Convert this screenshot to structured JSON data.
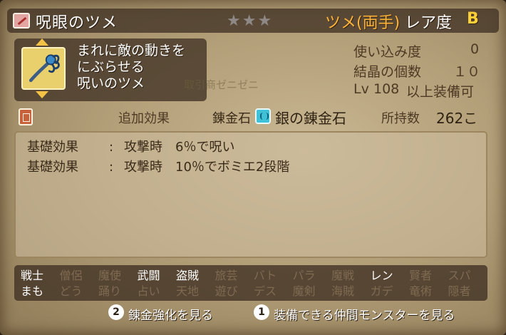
{
  "header": {
    "item_name": "呪眼のツメ",
    "stars": "★★★",
    "kind": "ツメ(両手)",
    "rarity_label": "レア度",
    "rarity_value": "B"
  },
  "item": {
    "description": [
      "まれに敵の動きを",
      "にぶらせる",
      "呪いのツメ"
    ],
    "icon": "claw-weapon-icon",
    "watermark": "取引商ゼニゼニ"
  },
  "stats": {
    "usage_label": "使い込み度",
    "usage_value": "0",
    "crystal_label": "結晶の個数",
    "crystal_value": "１０",
    "level_prefix": "Lv",
    "level_value": "108",
    "level_suffix": "以上装備可"
  },
  "effects_bar": {
    "added_effect_tab": "追加効果",
    "alchemy_stone_label": "錬金石",
    "alchemy_stone_name": "銀の錬金石",
    "owned_label": "所持数",
    "owned_value": "262こ"
  },
  "effects": [
    {
      "label": "基礎効果",
      "sep": ":",
      "text": "攻撃時　6％で呪い"
    },
    {
      "label": "基礎効果",
      "sep": ":",
      "text": "攻撃時　10％でボミエ2段階"
    }
  ],
  "jobs": {
    "row1": [
      {
        "label": "戦士",
        "on": true
      },
      {
        "label": "僧侶",
        "on": false
      },
      {
        "label": "魔使",
        "on": false
      },
      {
        "label": "武闘",
        "on": true
      },
      {
        "label": "盗賊",
        "on": true
      },
      {
        "label": "旅芸",
        "on": false
      },
      {
        "label": "バト",
        "on": false
      },
      {
        "label": "パラ",
        "on": false
      },
      {
        "label": "魔戦",
        "on": false
      },
      {
        "label": "レン",
        "on": true
      },
      {
        "label": "賢者",
        "on": false
      },
      {
        "label": "スパ",
        "on": false
      }
    ],
    "row2": [
      {
        "label": "まも",
        "on": true
      },
      {
        "label": "どう",
        "on": false
      },
      {
        "label": "踊り",
        "on": false
      },
      {
        "label": "占い",
        "on": false
      },
      {
        "label": "天地",
        "on": false
      },
      {
        "label": "遊び",
        "on": false
      },
      {
        "label": "デス",
        "on": false
      },
      {
        "label": "魔剣",
        "on": false
      },
      {
        "label": "海賊",
        "on": false
      },
      {
        "label": "ガデ",
        "on": false
      },
      {
        "label": "竜術",
        "on": false
      },
      {
        "label": "隠者",
        "on": false
      }
    ]
  },
  "footer": {
    "hint1_key": "2",
    "hint1_text": "錬金強化を見る",
    "hint2_key": "1",
    "hint2_text": "装備できる仲間モンスターを見る"
  }
}
